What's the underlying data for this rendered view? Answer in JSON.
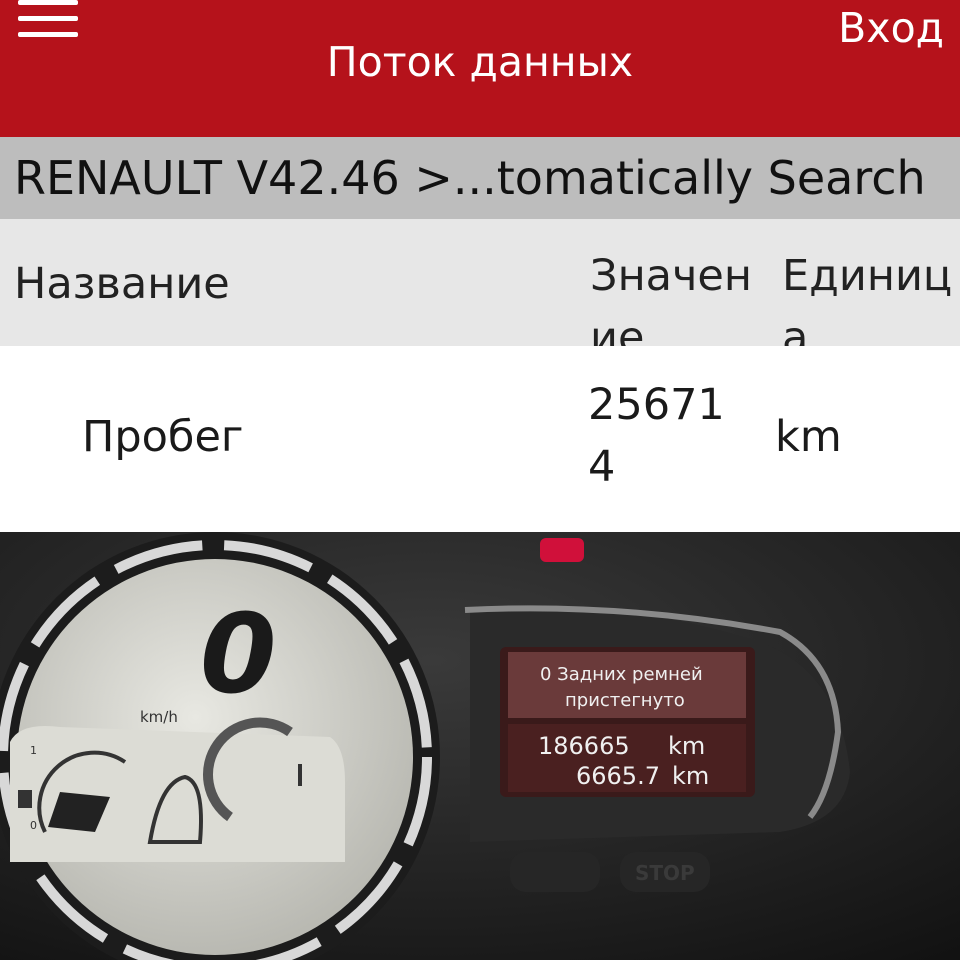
{
  "header": {
    "title": "Поток данных",
    "login_label": "Вход"
  },
  "breadcrumb": "RENAULT V42.46 >...tomatically Search",
  "table": {
    "columns": [
      "Название",
      "Значение",
      "Единица"
    ],
    "rows": [
      {
        "name": "Пробег",
        "value": "256714",
        "unit": "km"
      }
    ]
  },
  "dashboard": {
    "speed": "0",
    "speed_unit": "km/h",
    "message": [
      "0 Задних ремней",
      "пристегнуто"
    ],
    "odometer": "186665",
    "odometer_unit": "km",
    "trip": "6665.7",
    "trip_unit": "km",
    "fuel_scale": [
      "1",
      "0"
    ],
    "button_stop": "STOP"
  },
  "colors": {
    "header": "#b5121b",
    "breadcrumb": "#bdbdbd",
    "table_head": "#e7e7e7"
  }
}
